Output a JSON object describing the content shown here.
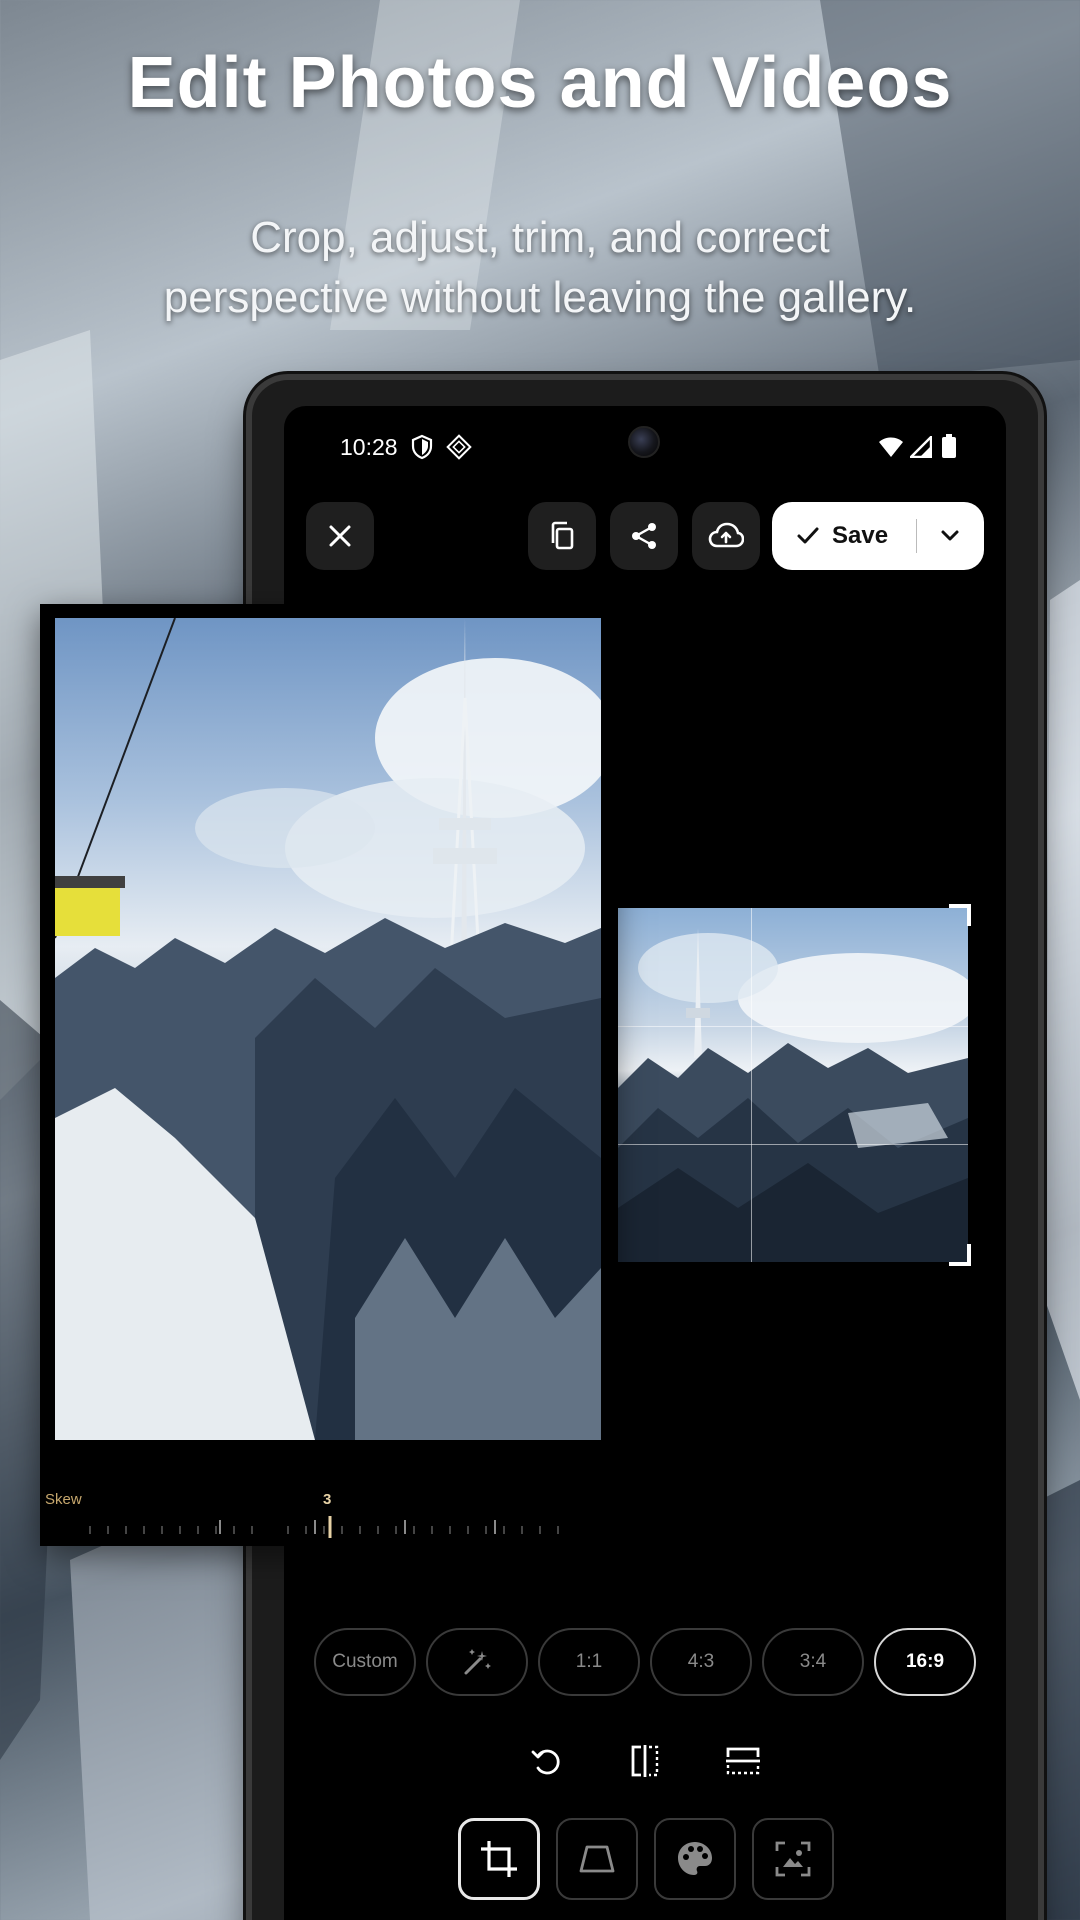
{
  "promo": {
    "headline": "Edit Photos and Videos",
    "subheadline_line1": "Crop, adjust, trim, and correct",
    "subheadline_line2": "perspective without leaving the gallery."
  },
  "status_bar": {
    "time": "10:28",
    "icons": [
      "shield-icon",
      "app-notification-icon",
      "wifi-icon",
      "cellular-signal-icon",
      "battery-icon"
    ]
  },
  "toolbar": {
    "close_icon": "close-icon",
    "copy_icon": "copy-icon",
    "share_icon": "share-icon",
    "upload_icon": "cloud-upload-icon",
    "save_label": "Save",
    "save_icon": "check-icon",
    "save_dropdown_icon": "chevron-down-icon"
  },
  "skew": {
    "label": "Skew",
    "value": "3"
  },
  "aspect_ratios": {
    "options": [
      "Custom",
      "auto",
      "1:1",
      "4:3",
      "3:4",
      "16:9"
    ],
    "selected": "16:9"
  },
  "transform_actions": [
    "rotate-icon",
    "flip-horizontal-icon",
    "flip-vertical-icon"
  ],
  "tool_tabs": {
    "items": [
      "crop-icon",
      "perspective-icon",
      "palette-icon",
      "image-adjust-icon"
    ],
    "active": "crop-icon"
  },
  "colors": {
    "save_background": "#ffffff",
    "selected_chip_border": "#d7d7d7",
    "skew_accent": "#c7a86e",
    "screen_background": "#000000"
  }
}
